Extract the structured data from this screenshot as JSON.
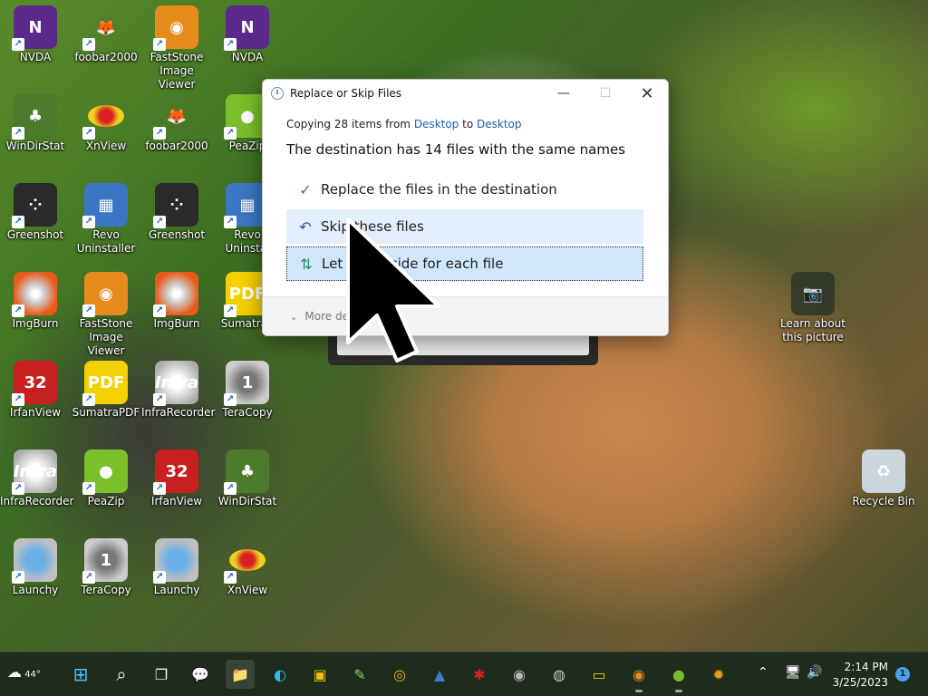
{
  "desktop": {
    "icons": [
      {
        "label": "NVDA",
        "glyph": "N"
      },
      {
        "label": "foobar2000",
        "glyph": "🦊"
      },
      {
        "label": "FastStone Image Viewer",
        "glyph": "◉"
      },
      {
        "label": "NVDA",
        "glyph": "N"
      },
      {
        "label": "WinDirStat",
        "glyph": "♣"
      },
      {
        "label": "XnView",
        "glyph": ""
      },
      {
        "label": "foobar2000",
        "glyph": "🦊"
      },
      {
        "label": "PeaZip",
        "glyph": "●"
      },
      {
        "label": "Greenshot",
        "glyph": "⁘"
      },
      {
        "label": "Revo Uninstaller",
        "glyph": "▦"
      },
      {
        "label": "Greenshot",
        "glyph": "⁘"
      },
      {
        "label": "Revo Uninstal",
        "glyph": "▦"
      },
      {
        "label": "ImgBurn",
        "glyph": ""
      },
      {
        "label": "FastStone Image Viewer",
        "glyph": "◉"
      },
      {
        "label": "ImgBurn",
        "glyph": ""
      },
      {
        "label": "SumatraP",
        "glyph": "PDF"
      },
      {
        "label": "IrfanView",
        "glyph": "32"
      },
      {
        "label": "SumatraPDF",
        "glyph": "PDF"
      },
      {
        "label": "InfraRecorder",
        "glyph": "Infra"
      },
      {
        "label": "TeraCopy",
        "glyph": "1"
      },
      {
        "label": "InfraRecorder",
        "glyph": "Infra"
      },
      {
        "label": "PeaZip",
        "glyph": "●"
      },
      {
        "label": "IrfanView",
        "glyph": "32"
      },
      {
        "label": "WinDirStat",
        "glyph": "♣"
      },
      {
        "label": "Launchy",
        "glyph": ""
      },
      {
        "label": "TeraCopy",
        "glyph": "1"
      },
      {
        "label": "Launchy",
        "glyph": ""
      },
      {
        "label": "XnView",
        "glyph": ""
      },
      {
        "label": "Learn about this picture",
        "glyph": "📷"
      },
      {
        "label": "Recycle Bin",
        "glyph": "♻"
      }
    ]
  },
  "dialog": {
    "title": "Replace or Skip Files",
    "minimize": "—",
    "maximize": "☐",
    "close": "✕",
    "copying_prefix": "Copying 28 items from ",
    "source": "Desktop",
    "copying_mid": " to ",
    "destination": "Desktop",
    "headline": "The destination has 14 files with the same names",
    "options": {
      "replace": {
        "icon": "✓",
        "label": "Replace the files in the destination"
      },
      "skip": {
        "icon": "↶",
        "label": "Skip these files"
      },
      "decide": {
        "icon": "⇅",
        "label": "Let me decide for each file"
      }
    },
    "more_details": "More details",
    "more_chevron": "⌄"
  },
  "taskbar": {
    "weather_temp": "44°",
    "weather_icon": "☁",
    "items": [
      {
        "name": "start",
        "glyph": "⊞"
      },
      {
        "name": "search",
        "glyph": "⌕"
      },
      {
        "name": "task-view",
        "glyph": "❐"
      },
      {
        "name": "chat",
        "glyph": "💬"
      },
      {
        "name": "file-explorer",
        "glyph": "📁"
      },
      {
        "name": "edge",
        "glyph": "◐"
      },
      {
        "name": "store",
        "glyph": "▣"
      },
      {
        "name": "notepad",
        "glyph": "✎"
      },
      {
        "name": "chrome",
        "glyph": "◎"
      },
      {
        "name": "app-blue",
        "glyph": "▲"
      },
      {
        "name": "irfanview",
        "glyph": "✱"
      },
      {
        "name": "disc",
        "glyph": "◉"
      },
      {
        "name": "infrarecorder",
        "glyph": "◍"
      },
      {
        "name": "sumatrapdf",
        "glyph": "▭"
      },
      {
        "name": "faststone",
        "glyph": "◉"
      },
      {
        "name": "peazip",
        "glyph": "●"
      },
      {
        "name": "xnview",
        "glyph": "✹"
      }
    ],
    "tray": {
      "chevron": "⌃",
      "network": "🖥",
      "volume": "🔊",
      "time": "2:14 PM",
      "date": "3/25/2023",
      "notifications": "1"
    }
  },
  "colors": {
    "accent": "#1a5fb4",
    "selected_option": "#cfe6fb",
    "hover_option": "#e2eefb",
    "check_green": "#2a8a2a"
  }
}
